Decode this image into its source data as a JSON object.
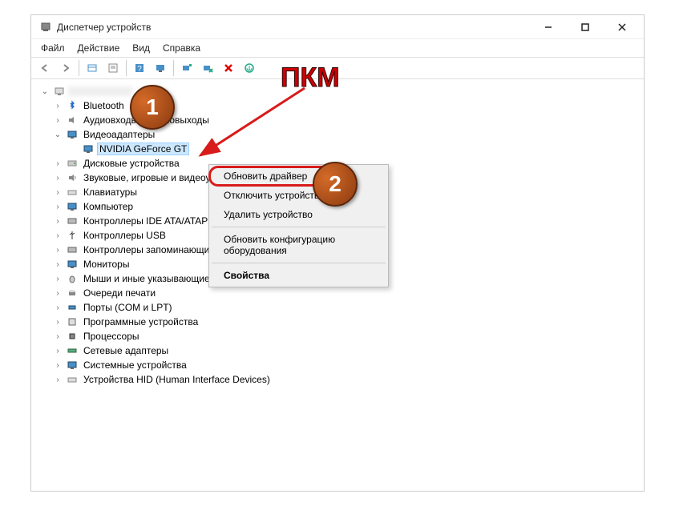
{
  "window": {
    "title": "Диспетчер устройств"
  },
  "menu": {
    "file": "Файл",
    "action": "Действие",
    "view": "Вид",
    "help": "Справка"
  },
  "tree": {
    "root": "",
    "items": [
      {
        "label": "Bluetooth"
      },
      {
        "label": "Аудиовходы и аудиовыходы"
      },
      {
        "label": "Видеоадаптеры"
      },
      {
        "label": "NVIDIA GeForce GT"
      },
      {
        "label": "Дисковые устройства"
      },
      {
        "label": "Звуковые, игровые и видеоустройства"
      },
      {
        "label": "Клавиатуры"
      },
      {
        "label": "Компьютер"
      },
      {
        "label": "Контроллеры IDE ATA/ATAPI"
      },
      {
        "label": "Контроллеры USB"
      },
      {
        "label": "Контроллеры запоминающих устройств"
      },
      {
        "label": "Мониторы"
      },
      {
        "label": "Мыши и иные указывающие устройства"
      },
      {
        "label": "Очереди печати"
      },
      {
        "label": "Порты (COM и LPT)"
      },
      {
        "label": "Программные устройства"
      },
      {
        "label": "Процессоры"
      },
      {
        "label": "Сетевые адаптеры"
      },
      {
        "label": "Системные устройства"
      },
      {
        "label": "Устройства HID (Human Interface Devices)"
      }
    ]
  },
  "context_menu": {
    "update_driver": "Обновить драйвер",
    "disable_device": "Отключить устройство",
    "uninstall_device": "Удалить устройство",
    "scan_hardware": "Обновить конфигурацию оборудования",
    "properties": "Свойства"
  },
  "annotations": {
    "pkm": "ПКМ",
    "badge1": "1",
    "badge2": "2"
  }
}
